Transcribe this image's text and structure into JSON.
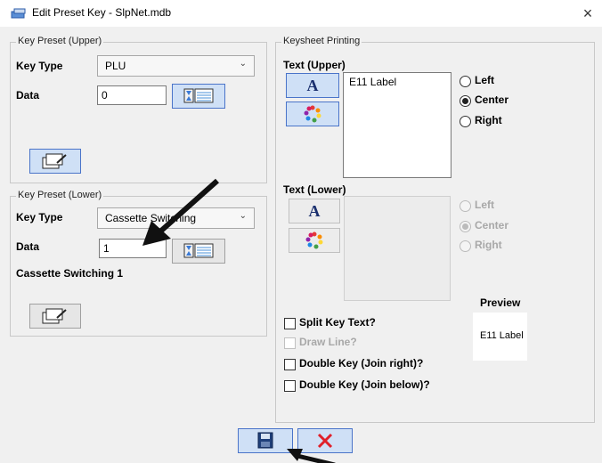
{
  "window": {
    "title": "Edit Preset Key - SlpNet.mdb",
    "close_glyph": "×"
  },
  "upper": {
    "group_label": "Key Preset (Upper)",
    "key_type_label": "Key Type",
    "key_type_value": "PLU",
    "data_label": "Data",
    "data_value": "0"
  },
  "lower": {
    "group_label": "Key Preset (Lower)",
    "key_type_label": "Key Type",
    "key_type_value": "Cassette Switching",
    "data_label": "Data",
    "data_value": "1",
    "description": "Cassette Switching 1"
  },
  "keysheet": {
    "group_label": "Keysheet Printing",
    "text_upper_label": "Text (Upper)",
    "text_upper_value": "E11 Label",
    "text_lower_label": "Text (Lower)",
    "text_lower_value": "",
    "font_button_glyph": "A",
    "align_upper": {
      "left": "Left",
      "center": "Center",
      "right": "Right",
      "selected": "Center"
    },
    "align_lower": {
      "left": "Left",
      "center": "Center",
      "right": "Right",
      "selected": "Center"
    },
    "preview_label": "Preview",
    "preview_text": "E11 Label",
    "split_key_text": {
      "label": "Split Key Text?",
      "checked": false
    },
    "draw_line": {
      "label": "Draw Line?",
      "checked": false,
      "disabled": true
    },
    "double_key_right": {
      "label": "Double Key (Join right)?",
      "checked": false
    },
    "double_key_below": {
      "label": "Double Key (Join below)?",
      "checked": false
    }
  },
  "icons": {
    "window": "app-icon",
    "save": "floppy-disk-icon",
    "cancel": "red-x-icon",
    "edit": "edit-pencil-icon",
    "picker": "list-picker-icon",
    "color": "color-wheel-icon"
  },
  "colors": {
    "accent": "#cfe0f6",
    "accent_border": "#4a74c9",
    "cancel_red": "#e0202a",
    "window_bg": "#f0f0f0"
  }
}
